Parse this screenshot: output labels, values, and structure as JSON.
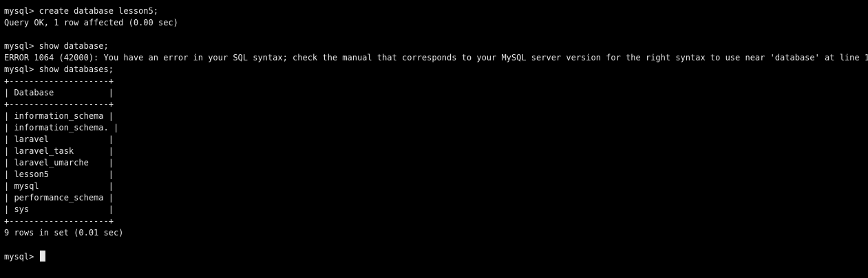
{
  "terminal": {
    "lines": [
      "mysql> create database lesson5;",
      "Query OK, 1 row affected (0.00 sec)",
      "",
      "mysql> show database;",
      "ERROR 1064 (42000): You have an error in your SQL syntax; check the manual that corresponds to your MySQL server version for the right syntax to use near 'database' at line 1",
      "mysql> show databases;",
      "+--------------------+",
      "| Database           |",
      "+--------------------+",
      "| information_schema |",
      "| information_schema. |",
      "| laravel            |",
      "| laravel_task       |",
      "| laravel_umarche    |",
      "| lesson5            |",
      "| mysql              |",
      "| performance_schema |",
      "| sys                |",
      "+--------------------+",
      "9 rows in set (0.01 sec)",
      ""
    ],
    "prompt": "mysql> ",
    "colors": {
      "background": "#000000",
      "foreground": "#e6e6e6"
    }
  }
}
